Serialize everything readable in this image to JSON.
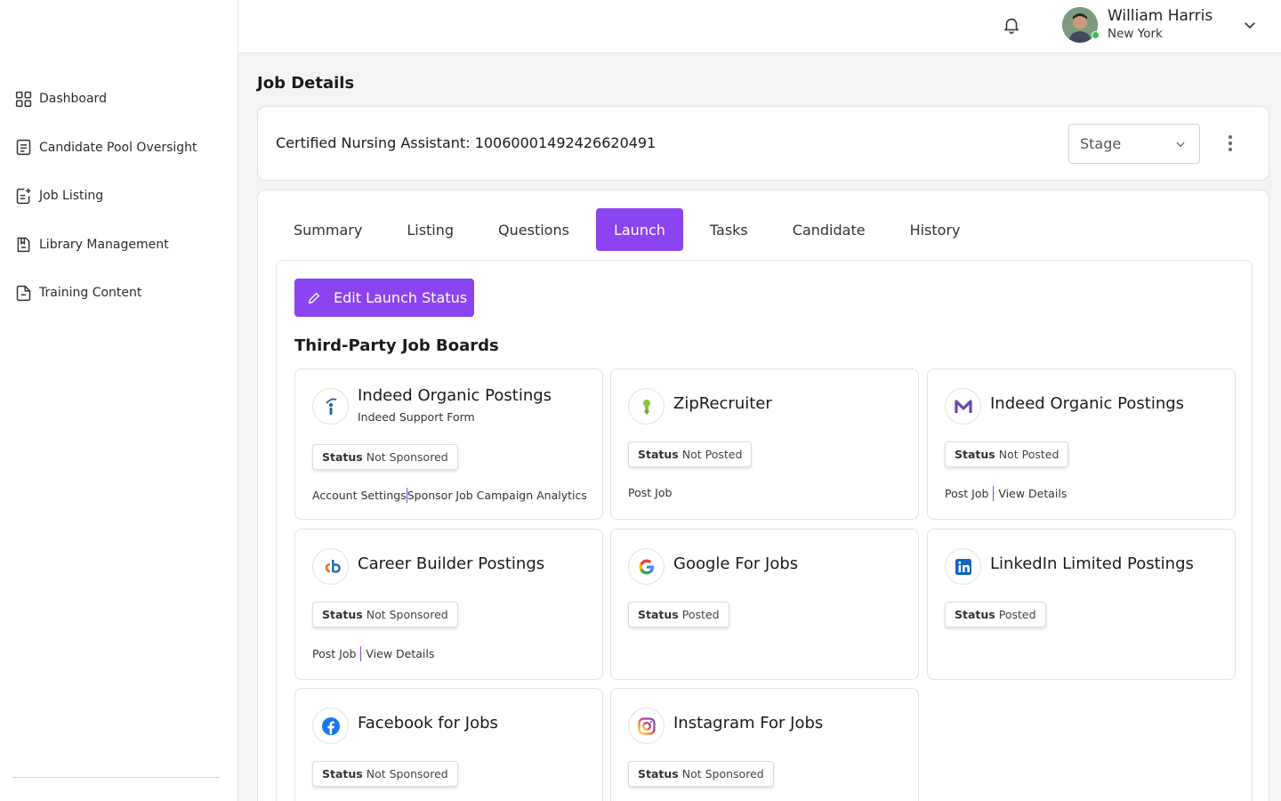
{
  "sidebar": {
    "items": [
      {
        "label": "Dashboard",
        "icon": "grid-icon"
      },
      {
        "label": "Candidate Pool Oversight",
        "icon": "document-list-icon"
      },
      {
        "label": "Job Listing",
        "icon": "document-add-icon"
      },
      {
        "label": "Library Management",
        "icon": "bookmark-document-icon"
      },
      {
        "label": "Training Content",
        "icon": "file-icon"
      }
    ]
  },
  "topbar": {
    "user_name": "William Harris",
    "user_location": "New York",
    "online_color": "#2ec55b"
  },
  "page": {
    "title": "Job Details",
    "job_title": "Certified Nursing Assistant: 1006000149242662049​1",
    "stage_label": "Stage"
  },
  "tabs": [
    "Summary",
    "Listing",
    "Questions",
    "Launch",
    "Tasks",
    "Candidate",
    "History"
  ],
  "active_tab": "Launch",
  "accent_color": "#8b44f0",
  "launch": {
    "edit_button": "Edit Launch Status",
    "section_title": "Third-Party Job Boards",
    "status_key": "Status",
    "boards": [
      {
        "name": "Indeed Organic Postings",
        "subtitle": "Indeed Support Form",
        "status": "Not Sponsored",
        "actions": [
          "Account Settings",
          "Sponsor Job Campaign Analytics"
        ],
        "logo": "indeed-icon"
      },
      {
        "name": "ZipRecruiter",
        "status": "Not Posted",
        "actions": [
          "Post Job"
        ],
        "logo": "ziprecruiter-icon"
      },
      {
        "name": "Indeed Organic Postings",
        "status": "Not Posted",
        "actions": [
          "Post Job",
          "View Details"
        ],
        "logo": "monster-m-icon"
      },
      {
        "name": "Career Builder Postings",
        "status": "Not Sponsored",
        "actions": [
          "Post Job",
          "View Details"
        ],
        "logo": "careerbuilder-icon"
      },
      {
        "name": "Google For Jobs",
        "status": "Posted",
        "actions": [],
        "logo": "google-icon"
      },
      {
        "name": "LinkedIn Limited Postings",
        "status": "Posted",
        "actions": [],
        "logo": "linkedin-icon"
      },
      {
        "name": "Facebook for Jobs",
        "status": "Not Sponsored",
        "actions": [],
        "logo": "facebook-icon"
      },
      {
        "name": "Instagram For Jobs",
        "status": "Not Sponsored",
        "actions": [],
        "logo": "instagram-icon"
      }
    ]
  }
}
